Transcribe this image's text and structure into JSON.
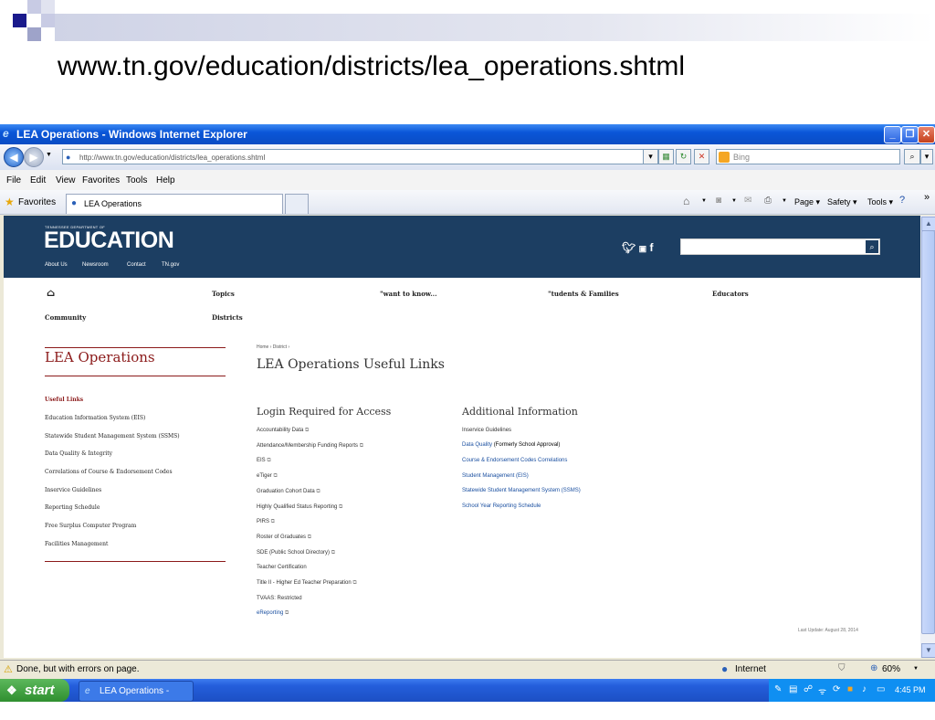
{
  "slide": {
    "title": "www.tn.gov/education/districts/lea_operations.shtml",
    "accent_color": "#1a1a8c"
  },
  "window": {
    "title": "LEA Operations - Windows Internet Explorer",
    "address": "http://www.tn.gov/education/districts/lea_operations.shtml",
    "address_domain": "tn.gov",
    "search_placeholder": "Bing",
    "menu": [
      "File",
      "Edit",
      "View",
      "Favorites",
      "Tools",
      "Help"
    ],
    "favorites_label": "Favorites",
    "tab_label": "LEA Operations",
    "command": {
      "page": "Page ▾",
      "safety": "Safety ▾",
      "tools": "Tools ▾"
    }
  },
  "site": {
    "dept_small": "TENNESSEE DEPARTMENT OF",
    "dept_big": "EDUCATION",
    "banner_nav": [
      "About Us",
      "Newsroom",
      "Contact",
      "TN.gov"
    ],
    "main_nav": {
      "topics": "Topics",
      "want": "\"want to know...",
      "students": "\"tudents & Families",
      "educators": "Educators",
      "community": "Community",
      "districts": "Districts"
    },
    "side": {
      "title": "LEA Operations",
      "useful": "Useful Links",
      "items": [
        "Education Information System (EIS)",
        "Statewide Student Management System (SSMS)",
        "Data Quality & Integrity",
        "Correlations of Course & Endorsement Codes",
        "Inservice Guidelines",
        "Reporting Schedule",
        "Free Surplus Computer Program",
        "Facilities Management"
      ]
    },
    "breadcrumb": "Home › District ›",
    "page_title": "LEA Operations Useful Links",
    "login_heading": "Login Required for Access",
    "login_links": [
      "Accountability Data",
      "Attendance/Membership Funding Reports",
      "EIS",
      "eTiger",
      "Graduation Cohort Data",
      "Highly Qualified Status Reporting",
      "PIRS",
      "Roster of Graduates",
      "SDE (Public School Directory)",
      "Teacher Certification",
      "Title II - Higher Ed Teacher Preparation",
      "TVAAS: Restricted",
      "eReporting"
    ],
    "additional_heading": "Additional Information",
    "additional_links": [
      "Inservice Guidelines",
      "Data Quality",
      "Course & Endorsement Codes Correlations",
      "Student Management (EIS)",
      "Statewide Student Management System (SSMS)",
      "School Year Reporting Schedule"
    ],
    "data_quality_note": "(Formerly School Approval)",
    "last_update": "Last Update: August 28, 2014"
  },
  "status": {
    "text": "Done, but with errors on page.",
    "zone": "Internet",
    "zoom": "60%"
  },
  "taskbar": {
    "start": "start",
    "item": "LEA Operations - Win...",
    "clock": "4:45 PM"
  }
}
